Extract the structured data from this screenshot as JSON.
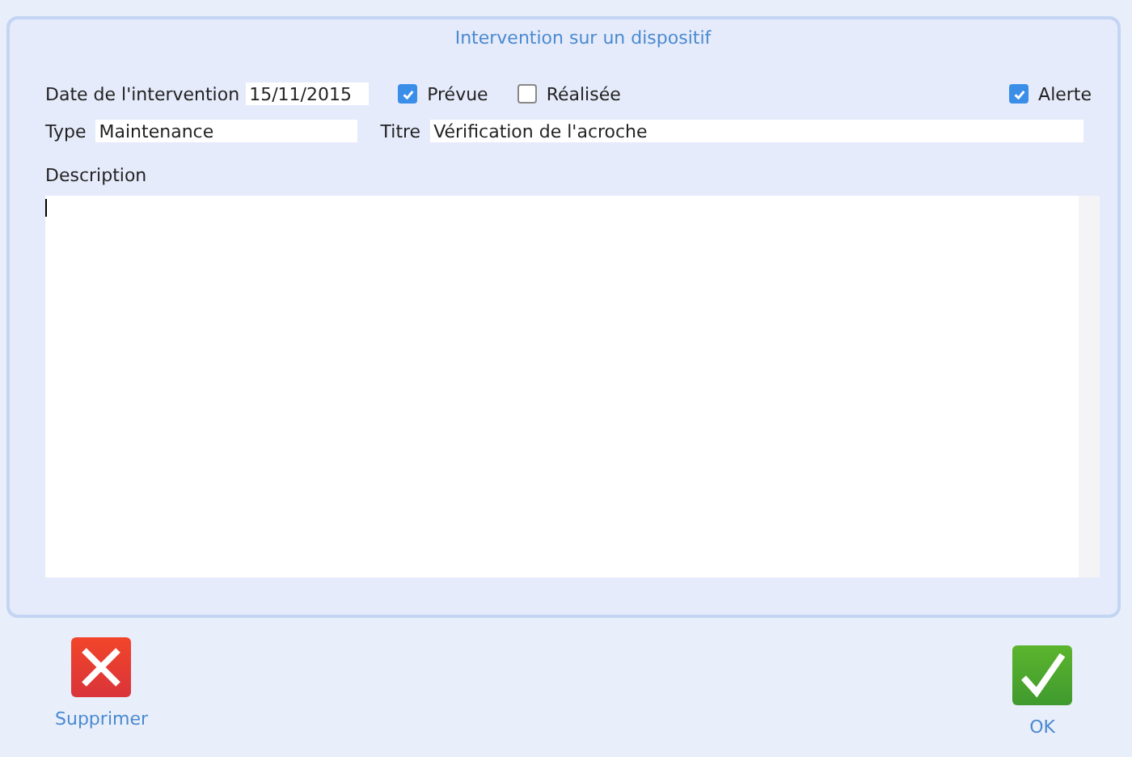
{
  "panel": {
    "title": "Intervention sur un dispositif"
  },
  "date": {
    "label": "Date de l'intervention",
    "value": "15/11/2015"
  },
  "checkboxes": [
    {
      "label": "Prévue",
      "checked": true
    },
    {
      "label": "Réalisée",
      "checked": false
    },
    {
      "label": "Alerte",
      "checked": true
    }
  ],
  "type": {
    "label": "Type",
    "value": "Maintenance"
  },
  "titre": {
    "label": "Titre",
    "value": "Vérification de l'acroche"
  },
  "description": {
    "label": "Description"
  },
  "buttons": [
    {
      "kind": "delete",
      "label": "Supprimer"
    },
    {
      "kind": "ok",
      "label": "OK"
    }
  ]
}
